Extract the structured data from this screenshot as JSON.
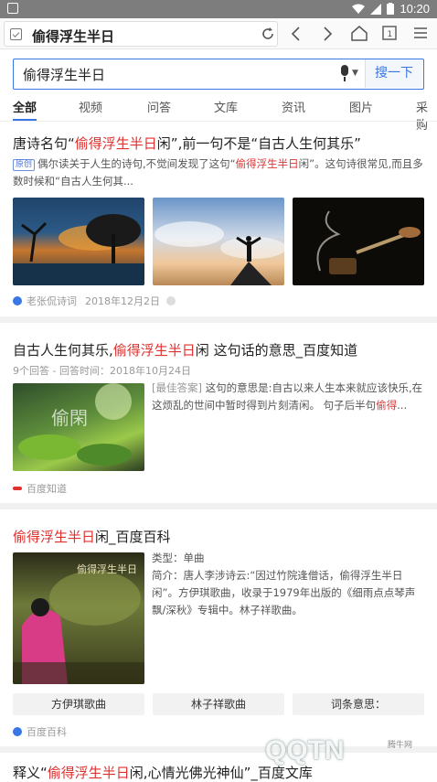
{
  "status": {
    "time": "10:20"
  },
  "toolbar": {
    "url_text": "偷得浮生半日"
  },
  "search": {
    "query": "偷得浮生半日",
    "button": "搜一下"
  },
  "tabs": [
    "全部",
    "视频",
    "问答",
    "文库",
    "资讯",
    "图片",
    "采购"
  ],
  "results": [
    {
      "title_pre": "唐诗名句“",
      "title_hl": "偷得浮生半日",
      "title_post": "闲”,前一句不是“自古人生何其乐”",
      "tag": "原创",
      "desc_pre": "偶尔读关于人生的诗句,不觉间发现了这句“",
      "desc_hl": "偷得浮生半日",
      "desc_post": "闲”。这句诗很常见,而且多数时候和“自古人生何其...",
      "source": "老张侃诗词",
      "date": "2018年12月2日"
    },
    {
      "title_pre": "自古人生何其乐,",
      "title_hl": "偷得浮生半日",
      "title_post": "闲 这句话的意思_百度知道",
      "meta": "9个回答 - 回答时间：2018年10月24日",
      "desc_prefix": "[最佳答案]",
      "desc": " 这句的意思是:自古以来人生本来就应该快乐,在这烦乱的世间中暂时得到片刻清闲。 句子后半句",
      "desc_hl": "偷得",
      "desc_tail": "...",
      "image_text": "偷閑",
      "source": "百度知道"
    },
    {
      "title_hl": "偷得浮生半日",
      "title_post": "闲_百度百科",
      "type_label": "类型：单曲",
      "intro": "简介：唐人李涉诗云:“因过竹院逢僧话，偷得浮生半日闲”。方伊琪歌曲，收录于1979年出版的《细雨点点琴声飘/深秋》专辑中。林子祥歌曲。",
      "image_text": "偷得浮生半日",
      "chips": [
        "方伊琪歌曲",
        "林子祥歌曲",
        "词条意思："
      ],
      "source": "百度百科"
    },
    {
      "title_pre": "释义“",
      "title_hl": "偷得浮生半日",
      "title_post": "闲,心情光佛光神仙”_百度文库"
    }
  ],
  "watermark": {
    "text": "QQTN",
    "small": "腾牛网"
  },
  "colors": {
    "accent": "#3a77e6",
    "highlight": "#e0312f"
  }
}
